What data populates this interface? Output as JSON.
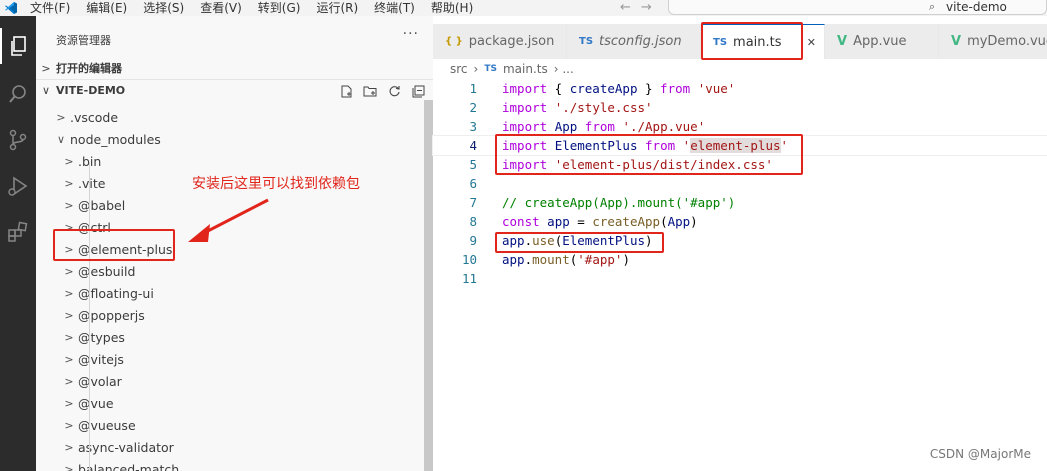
{
  "menubar": {
    "items": [
      "文件(F)",
      "编辑(E)",
      "选择(S)",
      "查看(V)",
      "转到(G)",
      "运行(R)",
      "终端(T)",
      "帮助(H)"
    ],
    "nav_arrows": "←→",
    "search_text": "vite-demo"
  },
  "sidebar": {
    "title": "资源管理器",
    "more": "···",
    "open_editors": "打开的编辑器",
    "project": "VITE-DEMO",
    "tree": [
      {
        "label": ".vscode",
        "level": 1
      },
      {
        "label": "node_modules",
        "level": 1,
        "expanded": true
      },
      {
        "label": ".bin",
        "level": 2
      },
      {
        "label": ".vite",
        "level": 2
      },
      {
        "label": "@babel",
        "level": 2
      },
      {
        "label": "@ctrl",
        "level": 2
      },
      {
        "label": "@element-plus",
        "level": 2
      },
      {
        "label": "@esbuild",
        "level": 2
      },
      {
        "label": "@floating-ui",
        "level": 2
      },
      {
        "label": "@popperjs",
        "level": 2
      },
      {
        "label": "@types",
        "level": 2
      },
      {
        "label": "@vitejs",
        "level": 2
      },
      {
        "label": "@volar",
        "level": 2
      },
      {
        "label": "@vue",
        "level": 2
      },
      {
        "label": "@vueuse",
        "level": 2
      },
      {
        "label": "async-validator",
        "level": 2
      },
      {
        "label": "balanced-match",
        "level": 2
      }
    ]
  },
  "annotation": {
    "text": "安装后这里可以找到依赖包"
  },
  "tabs": [
    {
      "icon": "{ }",
      "label": "package.json",
      "color": "#c49a00"
    },
    {
      "icon": "TS",
      "label": "tsconfig.json",
      "color": "#3178c6"
    },
    {
      "icon": "TS",
      "label": "main.ts",
      "color": "#3178c6",
      "active": true,
      "close": "✕"
    },
    {
      "icon": "V",
      "label": "App.vue",
      "color": "#41b883"
    },
    {
      "icon": "V",
      "label": "myDemo.vue",
      "color": "#41b883"
    }
  ],
  "breadcrumb": {
    "folder": "src",
    "sep": "›",
    "file_icon": "TS",
    "file": "main.ts",
    "tail": "› ..."
  },
  "editor": {
    "line_numbers": [
      "1",
      "2",
      "3",
      "4",
      "5",
      "6",
      "7",
      "8",
      "9",
      "10",
      "11"
    ],
    "current_line": 4,
    "lines": [
      [
        {
          "t": "import",
          "c": "kw"
        },
        {
          "t": " { ",
          "c": "plain"
        },
        {
          "t": "createApp",
          "c": "var"
        },
        {
          "t": " } ",
          "c": "plain"
        },
        {
          "t": "from",
          "c": "kw"
        },
        {
          "t": " ",
          "c": "plain"
        },
        {
          "t": "'vue'",
          "c": "str"
        }
      ],
      [
        {
          "t": "import",
          "c": "kw"
        },
        {
          "t": " ",
          "c": "plain"
        },
        {
          "t": "'./style.css'",
          "c": "str"
        }
      ],
      [
        {
          "t": "import",
          "c": "kw"
        },
        {
          "t": " ",
          "c": "plain"
        },
        {
          "t": "App",
          "c": "var"
        },
        {
          "t": " ",
          "c": "plain"
        },
        {
          "t": "from",
          "c": "kw"
        },
        {
          "t": " ",
          "c": "plain"
        },
        {
          "t": "'./App.vue'",
          "c": "str"
        }
      ],
      [
        {
          "t": "import",
          "c": "kw"
        },
        {
          "t": " ",
          "c": "plain"
        },
        {
          "t": "ElementPlus",
          "c": "var"
        },
        {
          "t": " ",
          "c": "plain"
        },
        {
          "t": "from",
          "c": "kw"
        },
        {
          "t": " '",
          "c": "str"
        },
        {
          "t": "element-plus",
          "c": "str hl"
        },
        {
          "t": "'",
          "c": "str"
        }
      ],
      [
        {
          "t": "import",
          "c": "kw"
        },
        {
          "t": " ",
          "c": "plain"
        },
        {
          "t": "'element-plus/dist/index.css'",
          "c": "str"
        }
      ],
      [],
      [
        {
          "t": "// createApp(App).mount('#app')",
          "c": "cm"
        }
      ],
      [
        {
          "t": "const",
          "c": "kw"
        },
        {
          "t": " ",
          "c": "plain"
        },
        {
          "t": "app",
          "c": "var"
        },
        {
          "t": " = ",
          "c": "plain"
        },
        {
          "t": "createApp",
          "c": "fn"
        },
        {
          "t": "(",
          "c": "plain"
        },
        {
          "t": "App",
          "c": "var"
        },
        {
          "t": ")",
          "c": "plain"
        }
      ],
      [
        {
          "t": "app",
          "c": "var"
        },
        {
          "t": ".",
          "c": "plain"
        },
        {
          "t": "use",
          "c": "fn"
        },
        {
          "t": "(",
          "c": "plain"
        },
        {
          "t": "ElementPlus",
          "c": "var"
        },
        {
          "t": ")",
          "c": "plain"
        }
      ],
      [
        {
          "t": "app",
          "c": "var"
        },
        {
          "t": ".",
          "c": "plain"
        },
        {
          "t": "mount",
          "c": "fn"
        },
        {
          "t": "(",
          "c": "plain"
        },
        {
          "t": "'#app'",
          "c": "str"
        },
        {
          "t": ")",
          "c": "plain"
        }
      ],
      []
    ]
  },
  "watermark": "CSDN @MajorMe",
  "colors": {
    "annotation": "#e1251b",
    "accent": "#005fb8",
    "activity_bar": "#2c2c2c"
  }
}
